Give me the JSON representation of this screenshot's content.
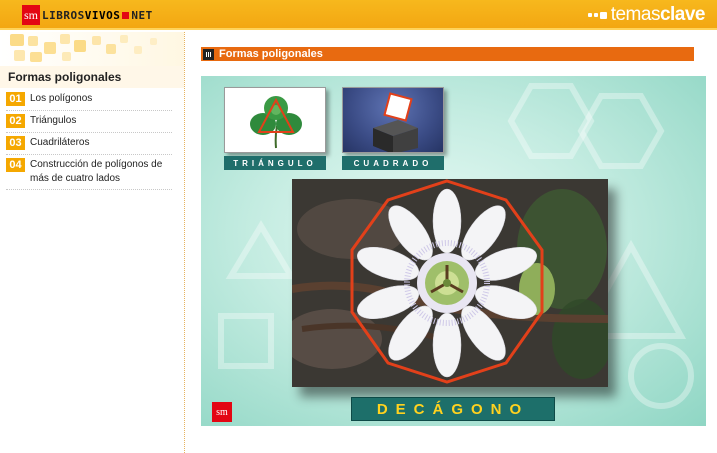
{
  "header": {
    "brand_sm": "sm",
    "brand_left": "LIBROS",
    "brand_mid": "VIVOS",
    "brand_right": "NET",
    "temas": "temas",
    "clave": "clave"
  },
  "sidebar": {
    "title": "Formas poligonales",
    "items": [
      {
        "num": "01",
        "label": "Los polígonos"
      },
      {
        "num": "02",
        "label": "Triángulos"
      },
      {
        "num": "03",
        "label": "Cuadriláteros"
      },
      {
        "num": "04",
        "label": "Construcción de polígonos de más de cuatro lados"
      }
    ]
  },
  "content": {
    "section_title": "Formas poligonales",
    "thumb_1_caption": "TRIÁNGULO",
    "thumb_2_caption": "CUADRADO",
    "main_caption": "DECÁGONO",
    "logo": "sm"
  },
  "colors": {
    "header": "#f3a712",
    "accent_orange": "#e86a10",
    "caption_teal": "#1d6f6a",
    "caption_yellow": "#ffd21f",
    "polygon_red": "#e2401a"
  }
}
